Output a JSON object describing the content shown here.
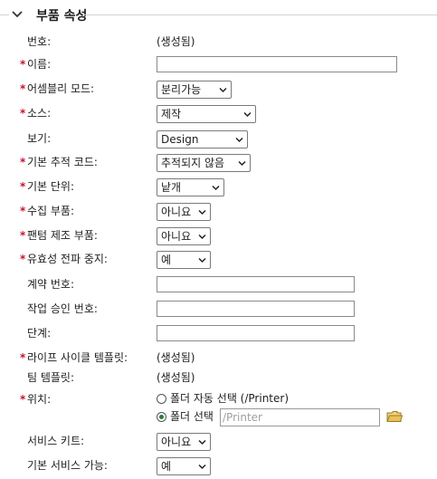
{
  "section": {
    "title": "부품 속성",
    "expanded": true
  },
  "fields": [
    {
      "label": "번호:",
      "required": false,
      "value": "(생성됨)"
    },
    {
      "label": "이름:",
      "required": true,
      "value": ""
    },
    {
      "label": "어셈블리 모드:",
      "required": true,
      "selected": "분리가능"
    },
    {
      "label": "소스:",
      "required": true,
      "selected": "제작"
    },
    {
      "label": "보기:",
      "required": false,
      "selected": "Design"
    },
    {
      "label": "기본 추적 코드:",
      "required": true,
      "selected": "추적되지 않음"
    },
    {
      "label": "기본 단위:",
      "required": true,
      "selected": "낱개"
    },
    {
      "label": "수집 부품:",
      "required": true,
      "selected": "아니요"
    },
    {
      "label": "팬텀 제조 부품:",
      "required": true,
      "selected": "아니요"
    },
    {
      "label": "유효성 전파 중지:",
      "required": true,
      "selected": "예"
    },
    {
      "label": "계약 번호:",
      "required": false,
      "value": ""
    },
    {
      "label": "작업 승인 번호:",
      "required": false,
      "value": ""
    },
    {
      "label": "단계:",
      "required": false,
      "value": ""
    },
    {
      "label": "라이프 사이클 템플릿:",
      "required": true,
      "value": "(생성됨)"
    },
    {
      "label": "팀 템플릿:",
      "required": false,
      "value": "(생성됨)"
    },
    {
      "label": "위치:",
      "required": true
    },
    {
      "label": "서비스 키트:",
      "required": false,
      "selected": "아니요"
    },
    {
      "label": "기본 서비스 가능:",
      "required": false,
      "selected": "예"
    }
  ],
  "location": {
    "auto_option": "폴더 자동 선택 (/Printer)",
    "manual_option": "폴더 선택",
    "selected": "manual",
    "path_placeholder": "/Printer"
  },
  "icons": {
    "chevron": "chevron-down-icon",
    "folder": "folder-icon",
    "dropdown": "dropdown-caret-icon"
  },
  "colors": {
    "required_marker": "#c8102e",
    "radio_selected": "#2b7a3c",
    "folder": "#e8c15a"
  }
}
